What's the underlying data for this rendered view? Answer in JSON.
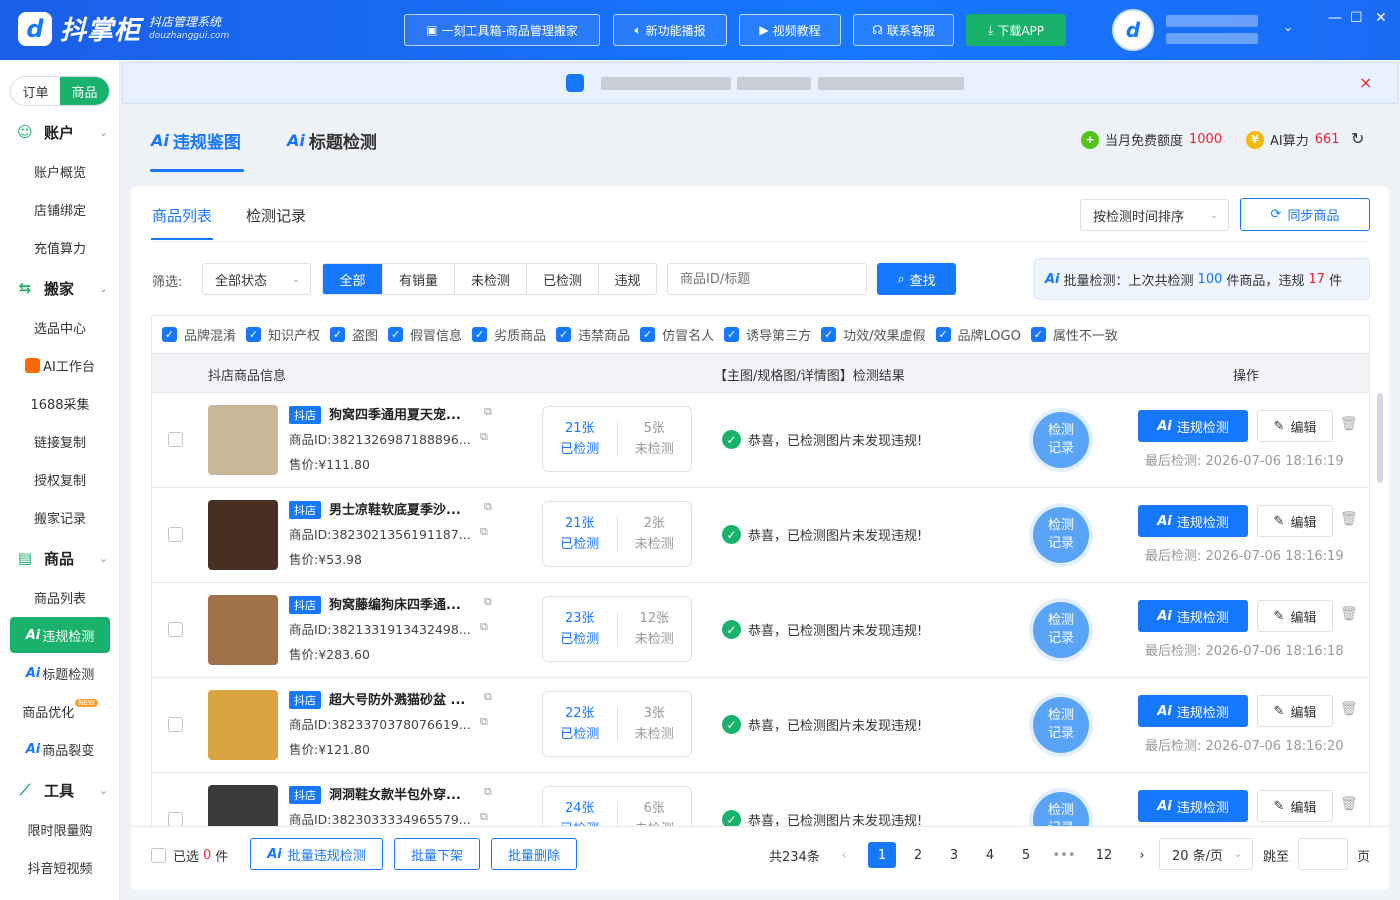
{
  "app": {
    "logo_mark": "d",
    "name": "抖掌柜",
    "subtitle": "抖店管理系统",
    "domain": "douzhanggui.com"
  },
  "topnav": [
    {
      "label": "一刻工具箱-商品管理搬家",
      "icon": "toolbox-icon"
    },
    {
      "label": "新功能播报",
      "icon": "speaker-icon"
    },
    {
      "label": "视频教程",
      "icon": "video-icon"
    },
    {
      "label": "联系客服",
      "icon": "headset-icon"
    },
    {
      "label": "下载APP",
      "icon": "download-icon"
    }
  ],
  "window_controls": {
    "minimize": "—",
    "maximize": "☐",
    "close": "✕"
  },
  "notice": {
    "close": "×"
  },
  "sidebar": {
    "segment": {
      "left": "订单",
      "right": "商品"
    },
    "groups": [
      {
        "label": "账户",
        "icon": "smile-icon",
        "items": [
          "账户概览",
          "店铺绑定",
          "充值算力"
        ]
      },
      {
        "label": "搬家",
        "icon": "move-icon",
        "items": [
          "选品中心",
          "AI工作台",
          "1688采集",
          "链接复制",
          "授权复制",
          "搬家记录"
        ]
      },
      {
        "label": "商品",
        "icon": "box-icon",
        "items": [
          "商品列表",
          "违规检测",
          "标题检测",
          "商品优化",
          "商品裂变"
        ]
      },
      {
        "label": "工具",
        "icon": "chart-icon",
        "items": [
          "限时限量购",
          "抖音短视频"
        ]
      }
    ],
    "ai_prefix": "Ai",
    "new_tag": "NEW"
  },
  "main_tabs": [
    {
      "ai": "Ai",
      "label": "违规鉴图"
    },
    {
      "ai": "Ai",
      "label": "标题检测"
    }
  ],
  "quota": {
    "free_label": "当月免费额度",
    "free_value": "1000",
    "ai_label": "AI算力",
    "ai_value": "661"
  },
  "sub_tabs": [
    "商品列表",
    "检测记录"
  ],
  "sort_select": "按检测时间排序",
  "sync_button": "同步商品",
  "filter": {
    "label": "筛选:",
    "status_select": "全部状态",
    "options": [
      "全部",
      "有销量",
      "未检测",
      "已检测",
      "违规"
    ],
    "search_placeholder": "商品ID/标题",
    "search_button": "查找"
  },
  "batch_info": {
    "ai": "Ai",
    "prefix": "批量检测：上次共检测",
    "count": "100",
    "mid": "件商品，违规",
    "violations": "17",
    "suffix": "件"
  },
  "categories": [
    "品牌混淆",
    "知识产权",
    "盗图",
    "假冒信息",
    "劣质商品",
    "违禁商品",
    "仿冒名人",
    "诱导第三方",
    "功效/效果虚假",
    "品牌LOGO",
    "属性不一致"
  ],
  "table_headers": {
    "info": "抖店商品信息",
    "result": "【主图/规格图/详情图】检测结果",
    "action": "操作"
  },
  "row_labels": {
    "shop_tag": "抖店",
    "id_prefix": "商品ID:",
    "price_prefix": "售价:",
    "checked": "已检测",
    "unchecked": "未检测",
    "record": "检测",
    "record2": "记录",
    "violation_btn": "违规检测",
    "edit_btn": "编辑",
    "last_prefix": "最后检测:"
  },
  "rows": [
    {
      "title": "狗窝四季通用夏天宠...",
      "id": "3821326987188896...",
      "price": "¥111.80",
      "checked": "21张",
      "unchecked": "5张",
      "result": "恭喜，已检测图片未发现违规!",
      "last": "2026-07-06 18:16:19",
      "thumb": "#c9b79a"
    },
    {
      "title": "男士凉鞋软底夏季沙...",
      "id": "3823021356191187...",
      "price": "¥53.98",
      "checked": "21张",
      "unchecked": "2张",
      "result": "恭喜，已检测图片未发现违规!",
      "last": "2026-07-06 18:16:19",
      "thumb": "#4a2f25"
    },
    {
      "title": "狗窝藤编狗床四季通...",
      "id": "3821331913432498...",
      "price": "¥283.60",
      "checked": "23张",
      "unchecked": "12张",
      "result": "恭喜，已检测图片未发现违规!",
      "last": "2026-07-06 18:16:18",
      "thumb": "#a0724a"
    },
    {
      "title": "超大号防外溅猫砂盆 ...",
      "id": "3823370378076619...",
      "price": "¥121.80",
      "checked": "22张",
      "unchecked": "3张",
      "result": "恭喜，已检测图片未发现违规!",
      "last": "2026-07-06 18:16:20",
      "thumb": "#d9a441"
    },
    {
      "title": "洞洞鞋女款半包外穿...",
      "id": "3823033334965579...",
      "price": "",
      "checked": "24张",
      "unchecked": "6张",
      "result": "恭喜，已检测图片未发现违规!",
      "last": "",
      "thumb": "#3b3b3b"
    }
  ],
  "footer": {
    "selected_prefix": "已选",
    "selected_count": "0",
    "selected_suffix": "件",
    "batch_violation": "批量违规检测",
    "batch_offshelf": "批量下架",
    "batch_delete": "批量删除",
    "total": "共234条",
    "pages": [
      "1",
      "2",
      "3",
      "4",
      "5",
      "•••",
      "12"
    ],
    "prev": "‹",
    "next": "›",
    "page_size": "20 条/页",
    "jump_label": "跳至",
    "jump_suffix": "页"
  },
  "colors": {
    "primary": "#1677ff",
    "green": "#19b26b",
    "danger": "#f5222d"
  }
}
